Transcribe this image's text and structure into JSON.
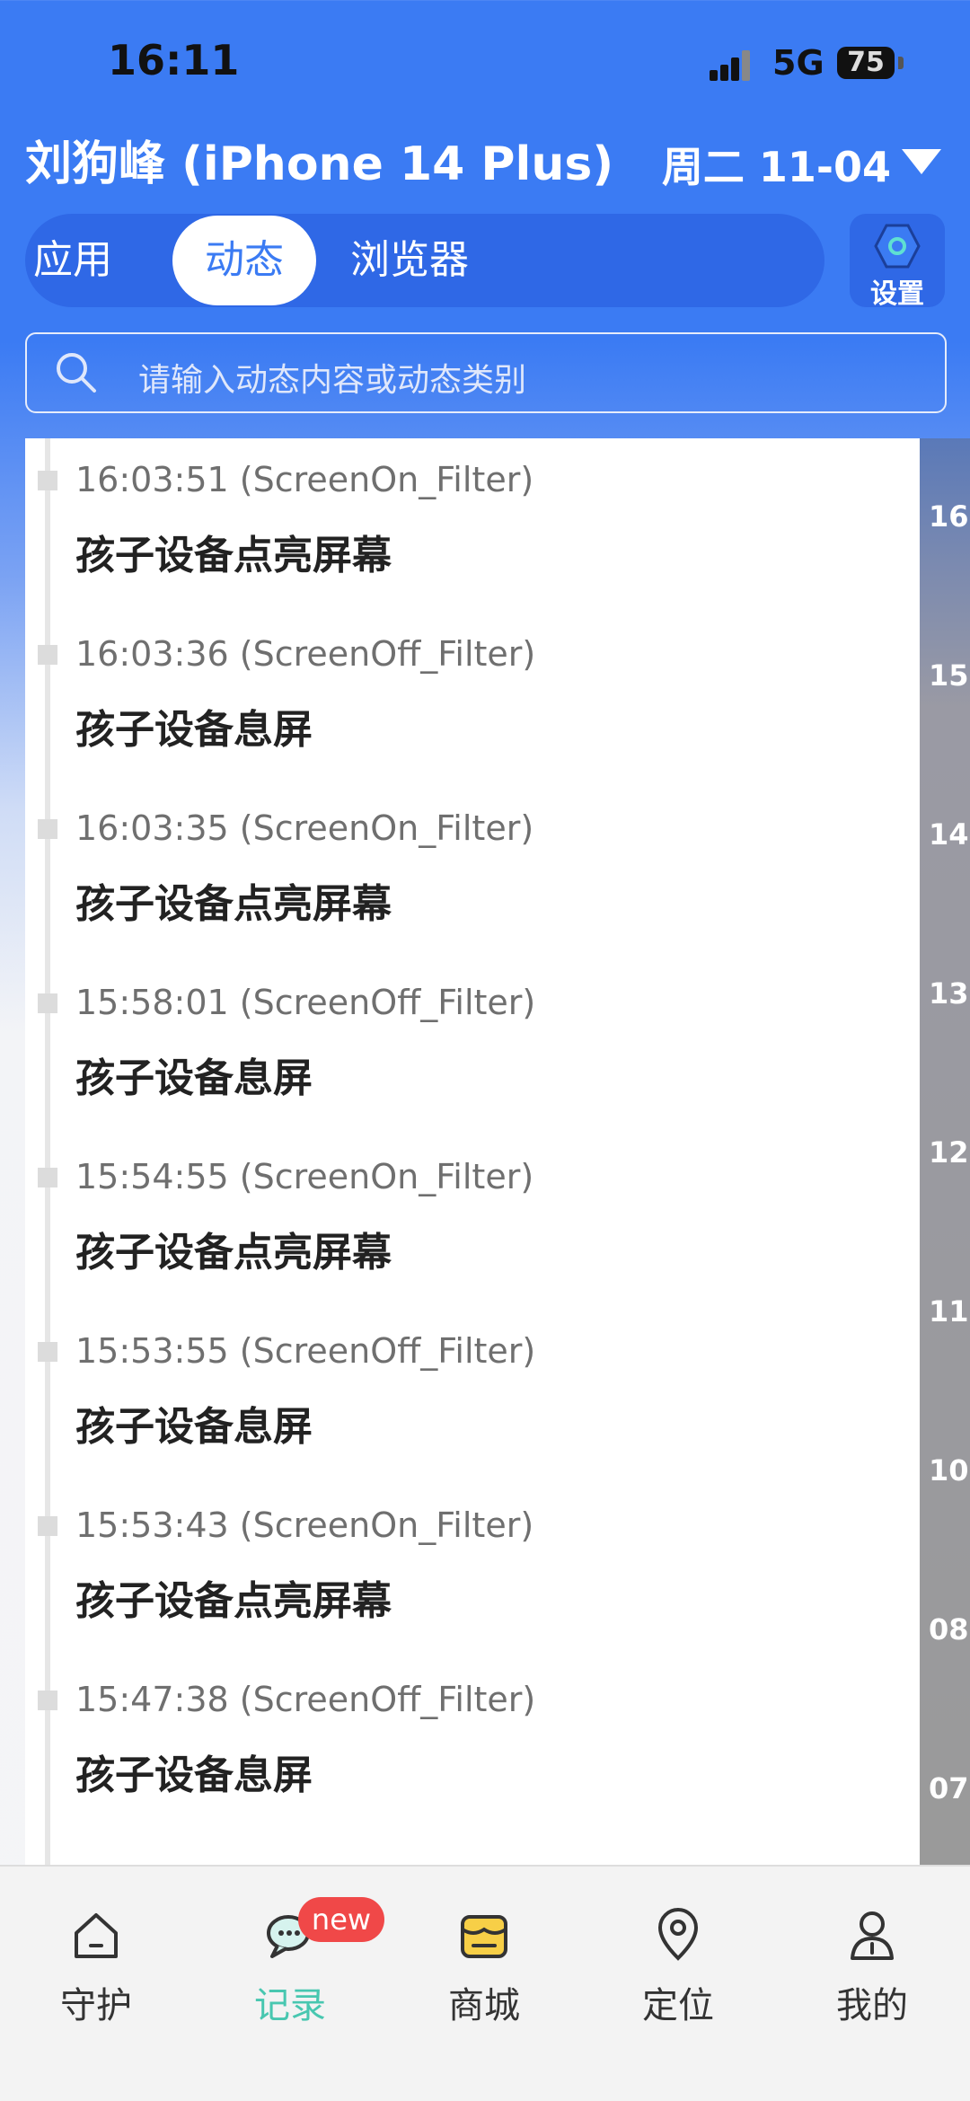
{
  "status": {
    "time": "16:11",
    "network": "5G",
    "battery": "75"
  },
  "header": {
    "title": "刘狗峰 (iPhone 14 Plus)",
    "date": "周二 11-04"
  },
  "tabs": [
    {
      "label": "应用",
      "active": false
    },
    {
      "label": "动态",
      "active": true
    },
    {
      "label": "浏览器",
      "active": false
    }
  ],
  "settings": {
    "label": "设置"
  },
  "search": {
    "placeholder": "请输入动态内容或动态类别"
  },
  "timeline_items": [
    {
      "time": "16:03:51 (ScreenOn_Filter)",
      "text": "孩子设备点亮屏幕"
    },
    {
      "time": "16:03:36 (ScreenOff_Filter)",
      "text": "孩子设备息屏"
    },
    {
      "time": "16:03:35 (ScreenOn_Filter)",
      "text": "孩子设备点亮屏幕"
    },
    {
      "time": "15:58:01 (ScreenOff_Filter)",
      "text": "孩子设备息屏"
    },
    {
      "time": "15:54:55 (ScreenOn_Filter)",
      "text": "孩子设备点亮屏幕"
    },
    {
      "time": "15:53:55 (ScreenOff_Filter)",
      "text": "孩子设备息屏"
    },
    {
      "time": "15:53:43 (ScreenOn_Filter)",
      "text": "孩子设备点亮屏幕"
    },
    {
      "time": "15:47:38 (ScreenOff_Filter)",
      "text": "孩子设备息屏"
    }
  ],
  "hour_rail": [
    "16",
    "15",
    "14",
    "13",
    "12",
    "11",
    "10",
    "08",
    "07"
  ],
  "bottom_nav": [
    {
      "label": "守护",
      "icon": "home-icon",
      "active": false
    },
    {
      "label": "记录",
      "icon": "chat-icon",
      "active": true
    },
    {
      "label": "商城",
      "icon": "shop-icon",
      "active": false
    },
    {
      "label": "定位",
      "icon": "location-pin-icon",
      "active": false
    },
    {
      "label": "我的",
      "icon": "profile-icon",
      "active": false
    }
  ],
  "badge": "new",
  "colors": {
    "primary": "#3b7bf3",
    "active_nav": "#48c7b0",
    "badge": "#f04848"
  }
}
